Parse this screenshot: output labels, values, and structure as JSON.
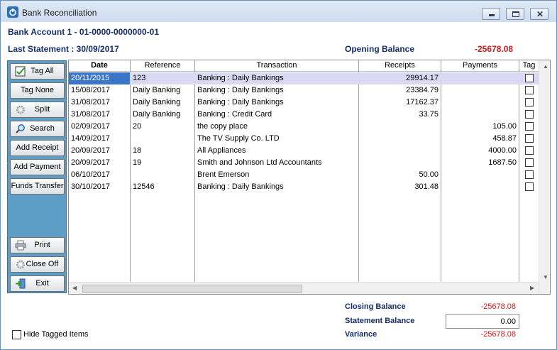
{
  "window": {
    "title": "Bank Reconciliation"
  },
  "header": {
    "account": "Bank Account 1 - 01-0000-0000000-01",
    "last_statement": "Last Statement : 30/09/2017",
    "opening_label": "Opening Balance",
    "opening_value": "-25678.08"
  },
  "sidebar": {
    "tag_all": "Tag All",
    "tag_none": "Tag None",
    "split": "Split",
    "search": "Search",
    "add_receipt": "Add Receipt",
    "add_payment": "Add Payment",
    "funds_transfer": "Funds Transfer",
    "print": "Print",
    "close_off": "Close Off",
    "exit": "Exit"
  },
  "table": {
    "columns": [
      "Date",
      "Reference",
      "Transaction",
      "Receipts",
      "Payments",
      "Tag"
    ],
    "rows": [
      {
        "date": "20/11/2015",
        "reference": "123",
        "transaction": "Banking : Daily Bankings",
        "receipts": "29914.17",
        "payments": ""
      },
      {
        "date": "15/08/2017",
        "reference": "Daily Banking",
        "transaction": "Banking : Daily Bankings",
        "receipts": "23384.79",
        "payments": ""
      },
      {
        "date": "31/08/2017",
        "reference": "Daily Banking",
        "transaction": "Banking : Daily Bankings",
        "receipts": "17162.37",
        "payments": ""
      },
      {
        "date": "31/08/2017",
        "reference": "Daily Banking",
        "transaction": "Banking : Credit Card",
        "receipts": "33.75",
        "payments": ""
      },
      {
        "date": "02/09/2017",
        "reference": "20",
        "transaction": "the copy place",
        "receipts": "",
        "payments": "105.00"
      },
      {
        "date": "14/09/2017",
        "reference": "",
        "transaction": "The TV Supply Co. LTD",
        "receipts": "",
        "payments": "458.87"
      },
      {
        "date": "20/09/2017",
        "reference": "18",
        "transaction": "All Appliances",
        "receipts": "",
        "payments": "4000.00"
      },
      {
        "date": "20/09/2017",
        "reference": "19",
        "transaction": "Smith and Johnson Ltd Accountants",
        "receipts": "",
        "payments": "1687.50"
      },
      {
        "date": "06/10/2017",
        "reference": "",
        "transaction": "Brent Emerson",
        "receipts": "50.00",
        "payments": ""
      },
      {
        "date": "30/10/2017",
        "reference": "12546",
        "transaction": "Banking : Daily Bankings",
        "receipts": "301.48",
        "payments": ""
      }
    ]
  },
  "footer": {
    "closing_label": "Closing Balance",
    "closing_value": "-25678.08",
    "statement_label": "Statement Balance",
    "statement_value": "0.00",
    "variance_label": "Variance",
    "variance_value": "-25678.08",
    "hide_tagged": "Hide Tagged Items"
  },
  "colors": {
    "accent_red": "#d21919",
    "label_blue": "#132e6b",
    "sidebar_blue": "#5e9ec6",
    "selection": "#3b75c7"
  }
}
